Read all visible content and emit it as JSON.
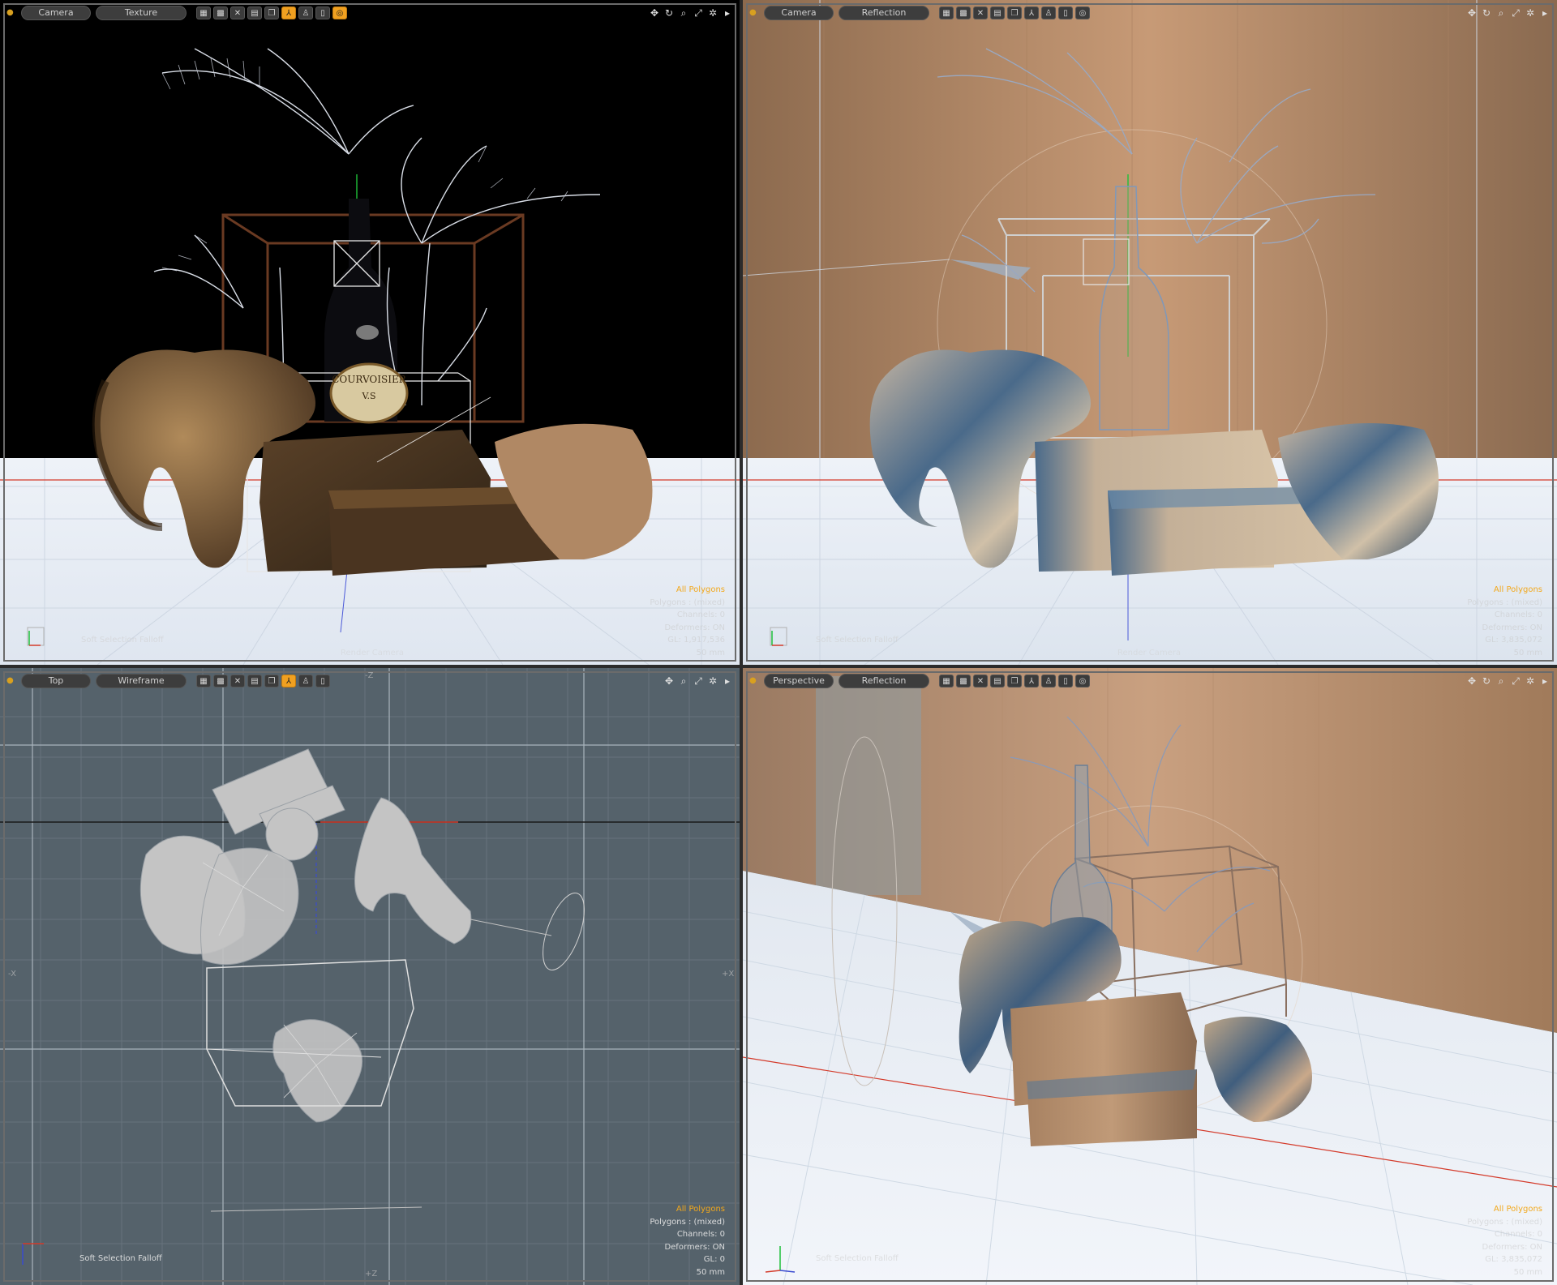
{
  "viewports": {
    "top_left": {
      "view": "Camera",
      "shading": "Texture",
      "info": {
        "line1": "All Polygons",
        "line2": "Polygons : (mixed)",
        "line3": "Channels: 0",
        "line4": "Deformers: ON",
        "line5": "GL: 1,917,536",
        "line6": "50 mm"
      },
      "soft_selection": "Soft Selection Falloff",
      "camera_label": "Render Camera",
      "label_text": "COURVOISIER",
      "label_sub": "V.S"
    },
    "top_right": {
      "view": "Camera",
      "shading": "Reflection",
      "info": {
        "line1": "All Polygons",
        "line2": "Polygons : (mixed)",
        "line3": "Channels: 0",
        "line4": "Deformers: ON",
        "line5": "GL: 3,835,072",
        "line6": "50 mm"
      },
      "soft_selection": "Soft Selection Falloff",
      "camera_label": "Render Camera"
    },
    "bottom_left": {
      "view": "Top",
      "shading": "Wireframe",
      "info": {
        "line1": "All Polygons",
        "line2": "Polygons : (mixed)",
        "line3": "Channels: 0",
        "line4": "Deformers: ON",
        "line5": "GL: 0",
        "line6": "50 mm"
      },
      "soft_selection": "Soft Selection Falloff",
      "axis_neg_x": "-X",
      "axis_pos_x": "+X",
      "axis_neg_z": "-Z",
      "axis_pos_z": "+Z"
    },
    "bottom_right": {
      "view": "Perspective",
      "shading": "Reflection",
      "info": {
        "line1": "All Polygons",
        "line2": "Polygons : (mixed)",
        "line3": "Channels: 0",
        "line4": "Deformers: ON",
        "line5": "GL: 3,835,072",
        "line6": "50 mm"
      },
      "soft_selection": "Soft Selection Falloff"
    }
  },
  "toolbar_icons": [
    "grid-solid-icon",
    "grid-checker-icon",
    "close-x-icon",
    "hatch-icon",
    "layers-icon",
    "axis-icon",
    "figure-icon",
    "bracket-icon",
    "ring-icon"
  ],
  "nav_icons": [
    "move-view-icon",
    "rotate-view-icon",
    "zoom-view-icon",
    "maximize-icon",
    "gear-icon",
    "menu-arrow-icon"
  ],
  "colors": {
    "active_tool": "#f0a020",
    "info_highlight": "#f2a81c",
    "viewport_border": "#6b6b6b"
  }
}
